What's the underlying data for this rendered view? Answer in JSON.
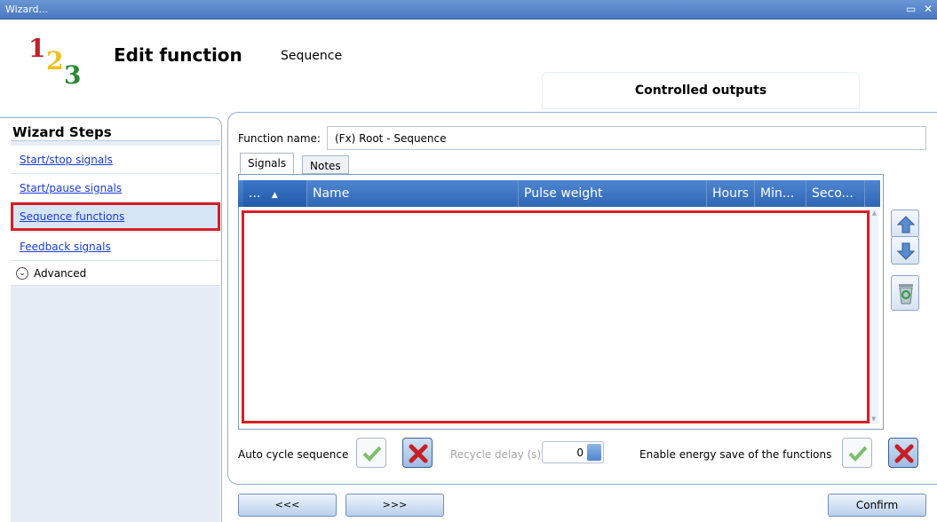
{
  "window": {
    "title": "Wizard...",
    "controls": [
      "restore-icon",
      "close-icon"
    ]
  },
  "header": {
    "logo_digits": [
      "1",
      "2",
      "3"
    ],
    "title": "Edit function",
    "subtitle": "Sequence",
    "tab_controlled_outputs": "Controlled outputs"
  },
  "sidebar": {
    "title": "Wizard Steps",
    "items": [
      {
        "label": "Start/stop signals"
      },
      {
        "label": "Start/pause signals"
      },
      {
        "label": "Sequence functions",
        "selected": true
      },
      {
        "label": "Feedback signals"
      }
    ],
    "advanced_label": "Advanced"
  },
  "form": {
    "function_name_label": "Function name:",
    "function_name_value": "(Fx) Root - Sequence",
    "tabs": [
      {
        "label": "Signals",
        "active": true
      },
      {
        "label": "Notes",
        "active": false
      }
    ],
    "grid": {
      "columns": [
        "...",
        "Name",
        "Pulse weight",
        "Hours",
        "Min...",
        "Seco..."
      ],
      "rows": []
    },
    "side_buttons": [
      "move-up-icon",
      "move-down-icon",
      "recycle-bin-icon"
    ],
    "auto_cycle_label": "Auto cycle sequence",
    "recycle_delay_label": "Recycle delay (s)",
    "recycle_delay_value": "0",
    "energy_save_label": "Enable energy save of the functions"
  },
  "footer": {
    "prev": "<<<",
    "next": ">>>",
    "confirm": "Confirm"
  },
  "colors": {
    "accent": "#4a78c0",
    "highlight": "#d91f26",
    "grid_header": "#3a72c4"
  }
}
